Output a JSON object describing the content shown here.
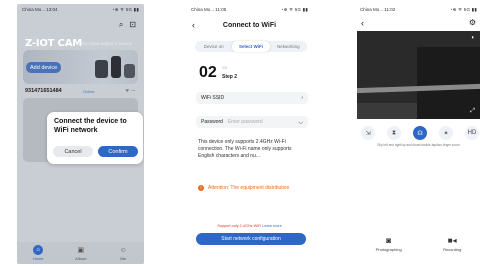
{
  "phone1": {
    "status": {
      "carrier": "China Mo...",
      "time": "13:04",
      "icons": "◔⊕ ᯤ 5G ▮▮"
    },
    "brand": "Z-IOT CAM",
    "tagline": "You have added 1 Device",
    "add_device_label": "Add device",
    "device": {
      "id": "931471651484",
      "status": "Online"
    },
    "dialog": {
      "title": "Connect the device to WiFi network",
      "cancel": "Cancel",
      "confirm": "Confirm"
    },
    "tabs": [
      {
        "label": "Home"
      },
      {
        "label": "Album"
      },
      {
        "label": "Me"
      }
    ]
  },
  "phone2": {
    "status": {
      "carrier": "China Mo...",
      "time": "11:05",
      "icons": "◔⊕ ᯤ 5G ▮▮"
    },
    "title": "Connect to WiFi",
    "steps": [
      "Device on",
      "Select WiFi",
      "Networking"
    ],
    "step_number": "02",
    "step_of": "/03",
    "step_label": "Step 2",
    "ssid_label": "WiFi SSID",
    "password_label": "Password",
    "password_placeholder": "Enter password",
    "info": "This device only supports 2.4GHz Wi-Fi connection. The Wi-Fi name only supports English characters and nu...",
    "attention": "Attention: The equipment distribution",
    "support_text": "Support only 2.4GHz WiFi",
    "learn_more": "Learn more",
    "start_button": "Start network configuration"
  },
  "phone3": {
    "status": {
      "carrier": "China Mo...",
      "time": "11:02",
      "icons": "◔⊕ ᯤ 5G ▮▮"
    },
    "controls": [
      "Fit",
      "Quality",
      "Talk",
      "Light",
      "HD"
    ],
    "hint": "Slip left and right/up and down/double-tap/two-finger zoom",
    "bottom": [
      {
        "label": "Photographing"
      },
      {
        "label": "Recording"
      }
    ]
  }
}
